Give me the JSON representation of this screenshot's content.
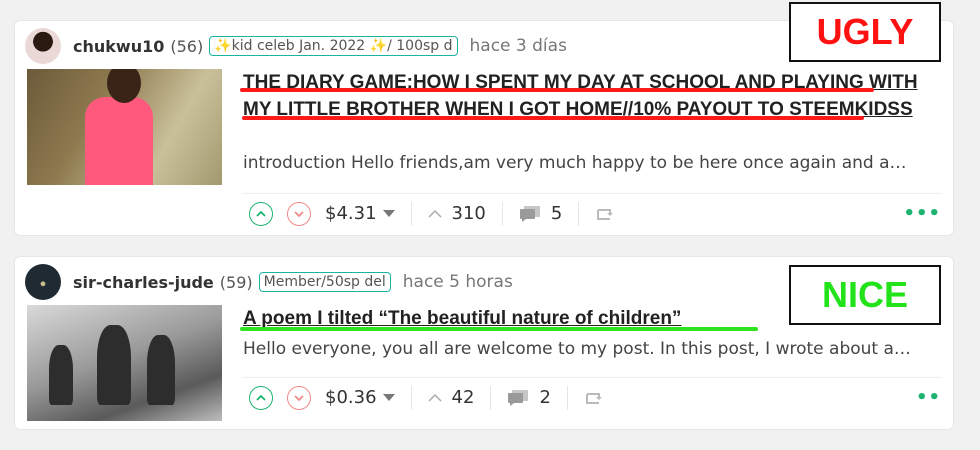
{
  "posts": [
    {
      "author": "chukwu10",
      "reputation": "(56)",
      "badge": "✨kid celeb Jan. 2022 ✨/ 100sp d",
      "time": "hace 3 días",
      "title": "THE DIARY GAME:HOW I SPENT MY DAY AT SCHOOL AND PLAYING WITH MY LITTLE BROTHER WHEN I GOT HOME//10% PAYOUT TO STEEMKIDSS",
      "excerpt": "introduction Hello friends,am very much happy to be here once again and a…",
      "payout": "$4.31",
      "votes": "310",
      "comments": "5"
    },
    {
      "author": "sir-charles-jude",
      "reputation": "(59)",
      "badge": "Member/50sp del",
      "time": "hace 5 horas",
      "title": "A poem I tilted “The beautiful nature of children”",
      "excerpt": "Hello everyone, you all are welcome to my post. In this post, I wrote about a…",
      "payout": "$0.36",
      "votes": "42",
      "comments": "2"
    }
  ],
  "annotations": {
    "ugly": "UGLY",
    "nice": "NICE"
  },
  "more": "•••",
  "more_small": "••",
  "colors": {
    "accent": "#1cb36f",
    "badge_border": "#1cb3a3",
    "ugly": "#ff1111",
    "nice": "#22e31a"
  }
}
